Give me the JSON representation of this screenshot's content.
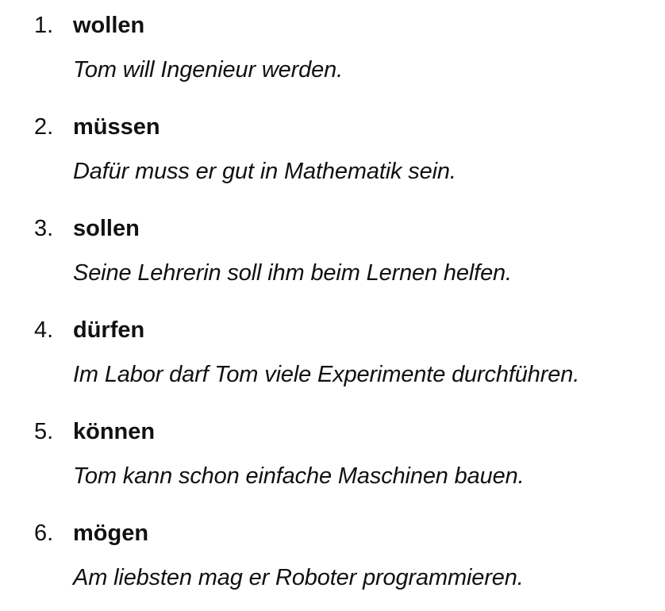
{
  "items": [
    {
      "number": "1.",
      "verb": "wollen",
      "example": "Tom will Ingenieur werden."
    },
    {
      "number": "2.",
      "verb": "müssen",
      "example": "Dafür muss er gut in Mathematik sein."
    },
    {
      "number": "3.",
      "verb": "sollen",
      "example": "Seine Lehrerin soll ihm beim Lernen helfen."
    },
    {
      "number": "4.",
      "verb": "dürfen",
      "example": "Im Labor darf Tom viele Experimente durchführen."
    },
    {
      "number": "5.",
      "verb": "können",
      "example": "Tom kann schon einfache Maschinen bauen."
    },
    {
      "number": "6.",
      "verb": "mögen",
      "example": "Am liebsten mag er Roboter programmieren."
    }
  ]
}
